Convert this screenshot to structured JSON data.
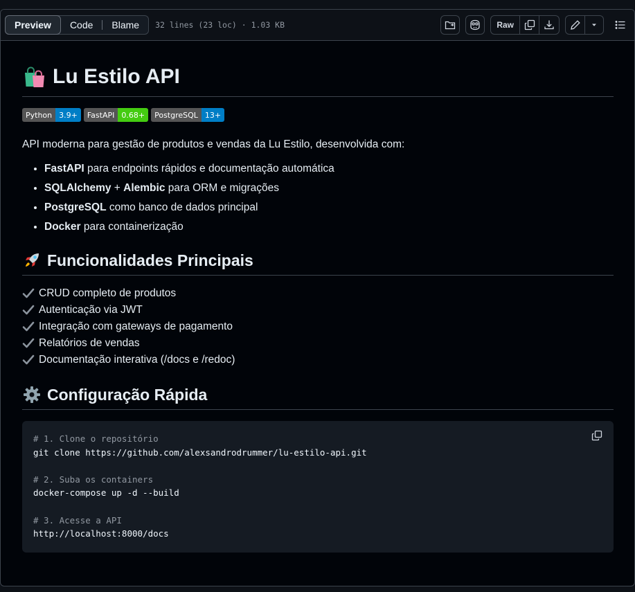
{
  "toolbar": {
    "tabs": [
      "Preview",
      "Code",
      "Blame"
    ],
    "meta": "32 lines (23 loc) · 1.03 KB",
    "raw_label": "Raw"
  },
  "readme": {
    "title": "Lu Estilo API",
    "title_emoji": "shopping-bags",
    "badges": [
      {
        "label": "Python",
        "value": "3.9+",
        "color": "#007ec6"
      },
      {
        "label": "FastAPI",
        "value": "0.68+",
        "color": "#4c1"
      },
      {
        "label": "PostgreSQL",
        "value": "13+",
        "color": "#007ec6"
      }
    ],
    "intro": "API moderna para gestão de produtos e vendas da Lu Estilo, desenvolvida com:",
    "stack": [
      {
        "strong": "FastAPI",
        "text": " para endpoints rápidos e documentação automática"
      },
      {
        "strong": "SQLAlchemy",
        "mid": " + ",
        "strong2": "Alembic",
        "text": " para ORM e migrações"
      },
      {
        "strong": "PostgreSQL",
        "text": " como banco de dados principal"
      },
      {
        "strong": "Docker",
        "text": " para containerização"
      }
    ],
    "features_heading": "Funcionalidades Principais",
    "features": [
      "CRUD completo de produtos",
      "Autenticação via JWT",
      "Integração com gateways de pagamento",
      "Relatórios de vendas",
      "Documentação interativa (/docs e /redoc)"
    ],
    "setup_heading": "Configuração Rápida",
    "code_lines": [
      {
        "kind": "cm",
        "text": "# 1. Clone o repositório"
      },
      {
        "kind": "cd",
        "text": "git clone https://github.com/alexsandrodrummer/lu-estilo-api.git"
      },
      {
        "kind": "cd",
        "text": ""
      },
      {
        "kind": "cm",
        "text": "# 2. Suba os containers"
      },
      {
        "kind": "cd",
        "text": "docker-compose up -d --build"
      },
      {
        "kind": "cd",
        "text": ""
      },
      {
        "kind": "cm",
        "text": "# 3. Acesse a API"
      },
      {
        "kind": "cd",
        "text": "http://localhost:8000/docs"
      }
    ]
  },
  "colors": {
    "background": "#0d1117",
    "border": "#3d444d",
    "text": "#e6edf3",
    "muted": "#9198a1",
    "code_bg": "#151b23"
  }
}
